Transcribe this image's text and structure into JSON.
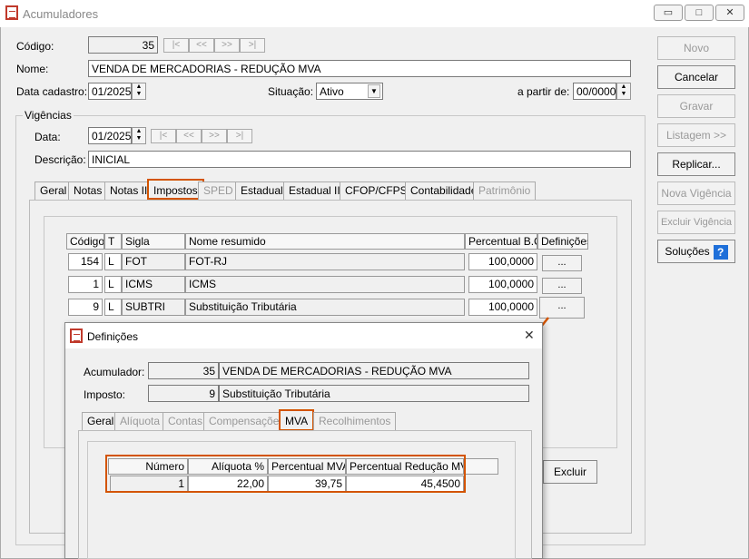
{
  "window": {
    "title": "Acumuladores",
    "min": "▭",
    "max": "□",
    "close": "✕"
  },
  "form": {
    "codigo_label": "Código:",
    "codigo_value": "35",
    "nav": {
      "first": "|<",
      "prev": "<<",
      "next": ">>",
      "last": ">|"
    },
    "nome_label": "Nome:",
    "nome_value": "VENDA DE MERCADORIAS - REDUÇÃO MVA",
    "data_cadastro_label": "Data cadastro:",
    "data_cadastro_value": "01/2025",
    "situacao_label": "Situação:",
    "situacao_value": "Ativo",
    "a_partir_label": "a partir de:",
    "a_partir_value": "00/0000"
  },
  "vigencias": {
    "legend": "Vigências",
    "data_label": "Data:",
    "data_value": "01/2025",
    "descricao_label": "Descrição:",
    "descricao_value": "INICIAL"
  },
  "tabs": [
    "Geral",
    "Notas",
    "Notas II",
    "Impostos",
    "SPED",
    "Estadual",
    "Estadual II",
    "CFOP/CFPS",
    "Contabilidade",
    "Patrimônio"
  ],
  "impostos_table": {
    "headers": [
      "Código",
      "T",
      "Sigla",
      "Nome resumido",
      "Percentual B.C.",
      "Definições"
    ],
    "rows": [
      {
        "codigo": "154",
        "t": "L",
        "sigla": "FOT",
        "nome": "FOT-RJ",
        "perc": "100,0000",
        "def": "..."
      },
      {
        "codigo": "1",
        "t": "L",
        "sigla": "ICMS",
        "nome": "ICMS",
        "perc": "100,0000",
        "def": "..."
      },
      {
        "codigo": "9",
        "t": "L",
        "sigla": "SUBTRI",
        "nome": "Substituição Tributária",
        "perc": "100,0000",
        "def": "..."
      }
    ]
  },
  "buttons": {
    "novo": "Novo",
    "cancelar": "Cancelar",
    "gravar": "Gravar",
    "listagem": "Listagem >>",
    "replicar": "Replicar...",
    "nova_vigencia": "Nova Vigência",
    "excluir_vigencia": "Excluir Vigência",
    "solucoes": "Soluções",
    "help": "?",
    "excluir": "Excluir"
  },
  "dialog": {
    "title": "Definições",
    "close": "✕",
    "acumulador_label": "Acumulador:",
    "acumulador_code": "35",
    "acumulador_name": "VENDA DE MERCADORIAS - REDUÇÃO MVA",
    "imposto_label": "Imposto:",
    "imposto_code": "9",
    "imposto_name": "Substituição Tributária",
    "tabs": [
      "Geral",
      "Alíquota",
      "Contas",
      "Compensações",
      "MVA",
      "Recolhimentos"
    ],
    "table": {
      "headers": [
        "Número",
        "Alíquota %",
        "Percentual MVA",
        "Percentual Redução MVA"
      ],
      "row": {
        "numero": "1",
        "aliquota": "22,00",
        "mva": "39,75",
        "reducao": "45,4500"
      }
    }
  },
  "colors": {
    "highlight": "#d35400",
    "help_icon": "#1e6fd9"
  }
}
